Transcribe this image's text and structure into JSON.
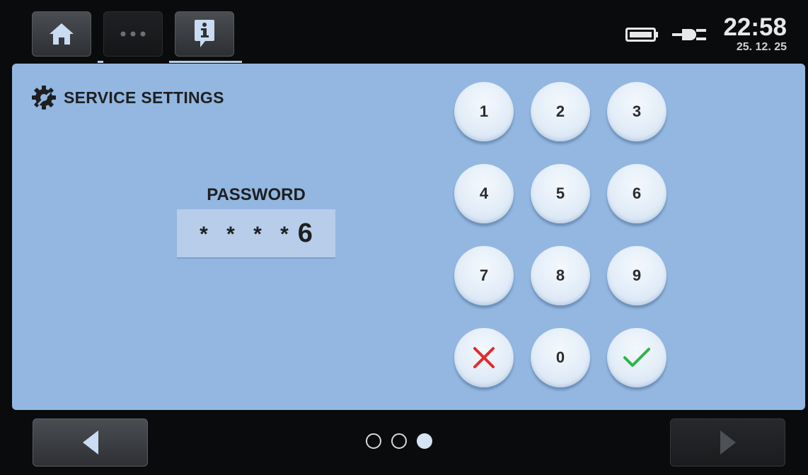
{
  "top_nav": {
    "home_icon": "home-icon",
    "more_icon": "more-dots-icon",
    "info_icon": "info-icon"
  },
  "status": {
    "battery_icon": "battery-icon",
    "plug_icon": "power-plug-icon",
    "time": "22:58",
    "date": "25. 12. 25"
  },
  "panel": {
    "icon": "wrench-gear-icon",
    "title": "SERVICE SETTINGS",
    "password_label": "PASSWORD",
    "password_mask": "* * * *",
    "password_last_digit": "6"
  },
  "keypad": {
    "keys": [
      "1",
      "2",
      "3",
      "4",
      "5",
      "6",
      "7",
      "8",
      "9",
      "0"
    ],
    "cancel_icon": "cancel-x-icon",
    "confirm_icon": "confirm-check-icon"
  },
  "pager": {
    "pages": 3,
    "current_page": 3
  },
  "colors": {
    "panel": "#93b7e0",
    "cancel": "#e32a2a",
    "confirm": "#2fb34a"
  }
}
